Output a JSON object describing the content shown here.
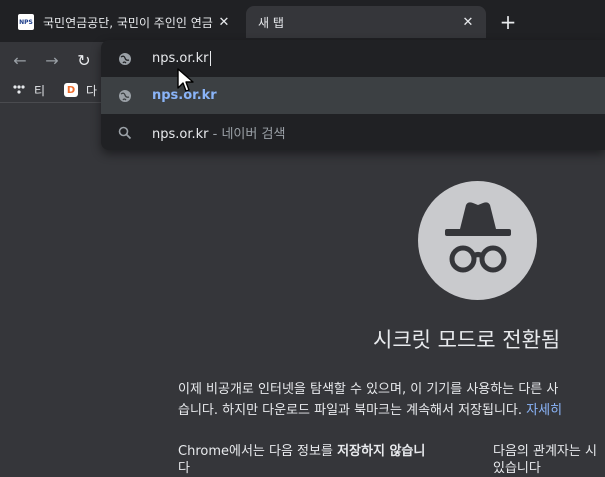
{
  "tabs": [
    {
      "title": "국민연금공단, 국민이 주인인 연금",
      "favicon_text": "NPS",
      "active": false
    },
    {
      "title": "새 탭",
      "active": true
    }
  ],
  "tab_close_glyph": "✕",
  "new_tab_glyph": "+",
  "toolbar": {
    "back_glyph": "←",
    "forward_glyph": "→",
    "reload_glyph": "↻"
  },
  "bookmarks": [
    {
      "label": "티",
      "icon_color": "#202124"
    },
    {
      "label": "다",
      "icon_letter": "D",
      "icon_color": "#f06c2b"
    }
  ],
  "omnibox": {
    "input_value": "nps.or.kr",
    "suggestions": [
      {
        "icon": "globe-icon",
        "text": "nps.or.kr",
        "suffix": ""
      },
      {
        "icon": "search-icon",
        "text": "nps.or.kr",
        "suffix": " - 네이버 검색"
      }
    ]
  },
  "incognito": {
    "title": "시크릿 모드로 전환됨",
    "line1": "이제 비공개로 인터넷을 탐색할 수 있으며, 이 기기를 사용하는 다른 사",
    "line2": "습니다. 하지만 다운로드 파일과 북마크는 계속해서 저장됩니다.",
    "line2_link": " 자세히",
    "left_section_prefix": "Chrome에서는 다음 정보를 ",
    "left_section_bold": "저장하지 않습니",
    "left_section_cont": "다",
    "right_section": "다음의 관계자는 시",
    "right_section_cont": "있습니다"
  },
  "colors": {
    "frame": "#202124",
    "surface": "#35363a",
    "link": "#8ab4f8",
    "icon_circle": "#c9cacd"
  }
}
